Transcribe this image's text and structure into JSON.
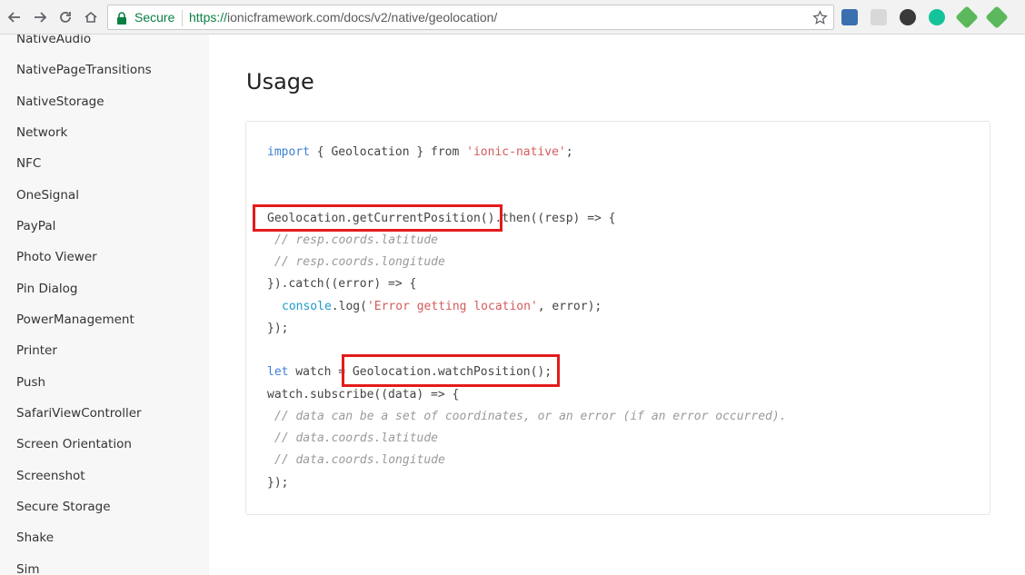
{
  "browser": {
    "secure_label": "Secure",
    "url_scheme": "https://",
    "url_domain": "ionicframework.com",
    "url_path": "/docs/v2/native/geolocation/",
    "icons": [
      "back-icon",
      "forward-icon",
      "reload-icon",
      "home-icon",
      "lock-icon",
      "star-icon"
    ]
  },
  "sidebar": {
    "items": [
      {
        "label": "NativeAudio"
      },
      {
        "label": "NativePageTransitions"
      },
      {
        "label": "NativeStorage"
      },
      {
        "label": "Network"
      },
      {
        "label": "NFC"
      },
      {
        "label": "OneSignal"
      },
      {
        "label": "PayPal"
      },
      {
        "label": "Photo Viewer"
      },
      {
        "label": "Pin Dialog"
      },
      {
        "label": "PowerManagement"
      },
      {
        "label": "Printer"
      },
      {
        "label": "Push"
      },
      {
        "label": "SafariViewController"
      },
      {
        "label": "Screen Orientation"
      },
      {
        "label": "Screenshot"
      },
      {
        "label": "Secure Storage"
      },
      {
        "label": "Shake"
      },
      {
        "label": "Sim"
      }
    ]
  },
  "main": {
    "title": "Usage",
    "code": {
      "l1_kw": "import",
      "l1_mid": " { Geolocation } from ",
      "l1_str": "'ionic-native'",
      "l1_end": ";",
      "l2": "Geolocation.getCurrentPosition().then((resp) => {",
      "l3": "// resp.coords.latitude",
      "l4": "// resp.coords.longitude",
      "l5": "}).catch((error) => {",
      "l6_con": "console",
      "l6_mid": ".log(",
      "l6_str": "'Error getting location'",
      "l6_end": ", error);",
      "l7": "});",
      "l8_kw": "let",
      "l8_rest": " watch = Geolocation.watchPosition();",
      "l9": "watch.subscribe((data) => {",
      "l10": "// data can be a set of coordinates, or an error (if an error occurred).",
      "l11": "// data.coords.latitude",
      "l12": "// data.coords.longitude",
      "l13": "});"
    }
  },
  "colors": {
    "secure_green": "#0b8043",
    "keyword_blue": "#3b7fd6",
    "string_red": "#d45b5b",
    "highlight_red": "#e31b1b"
  }
}
